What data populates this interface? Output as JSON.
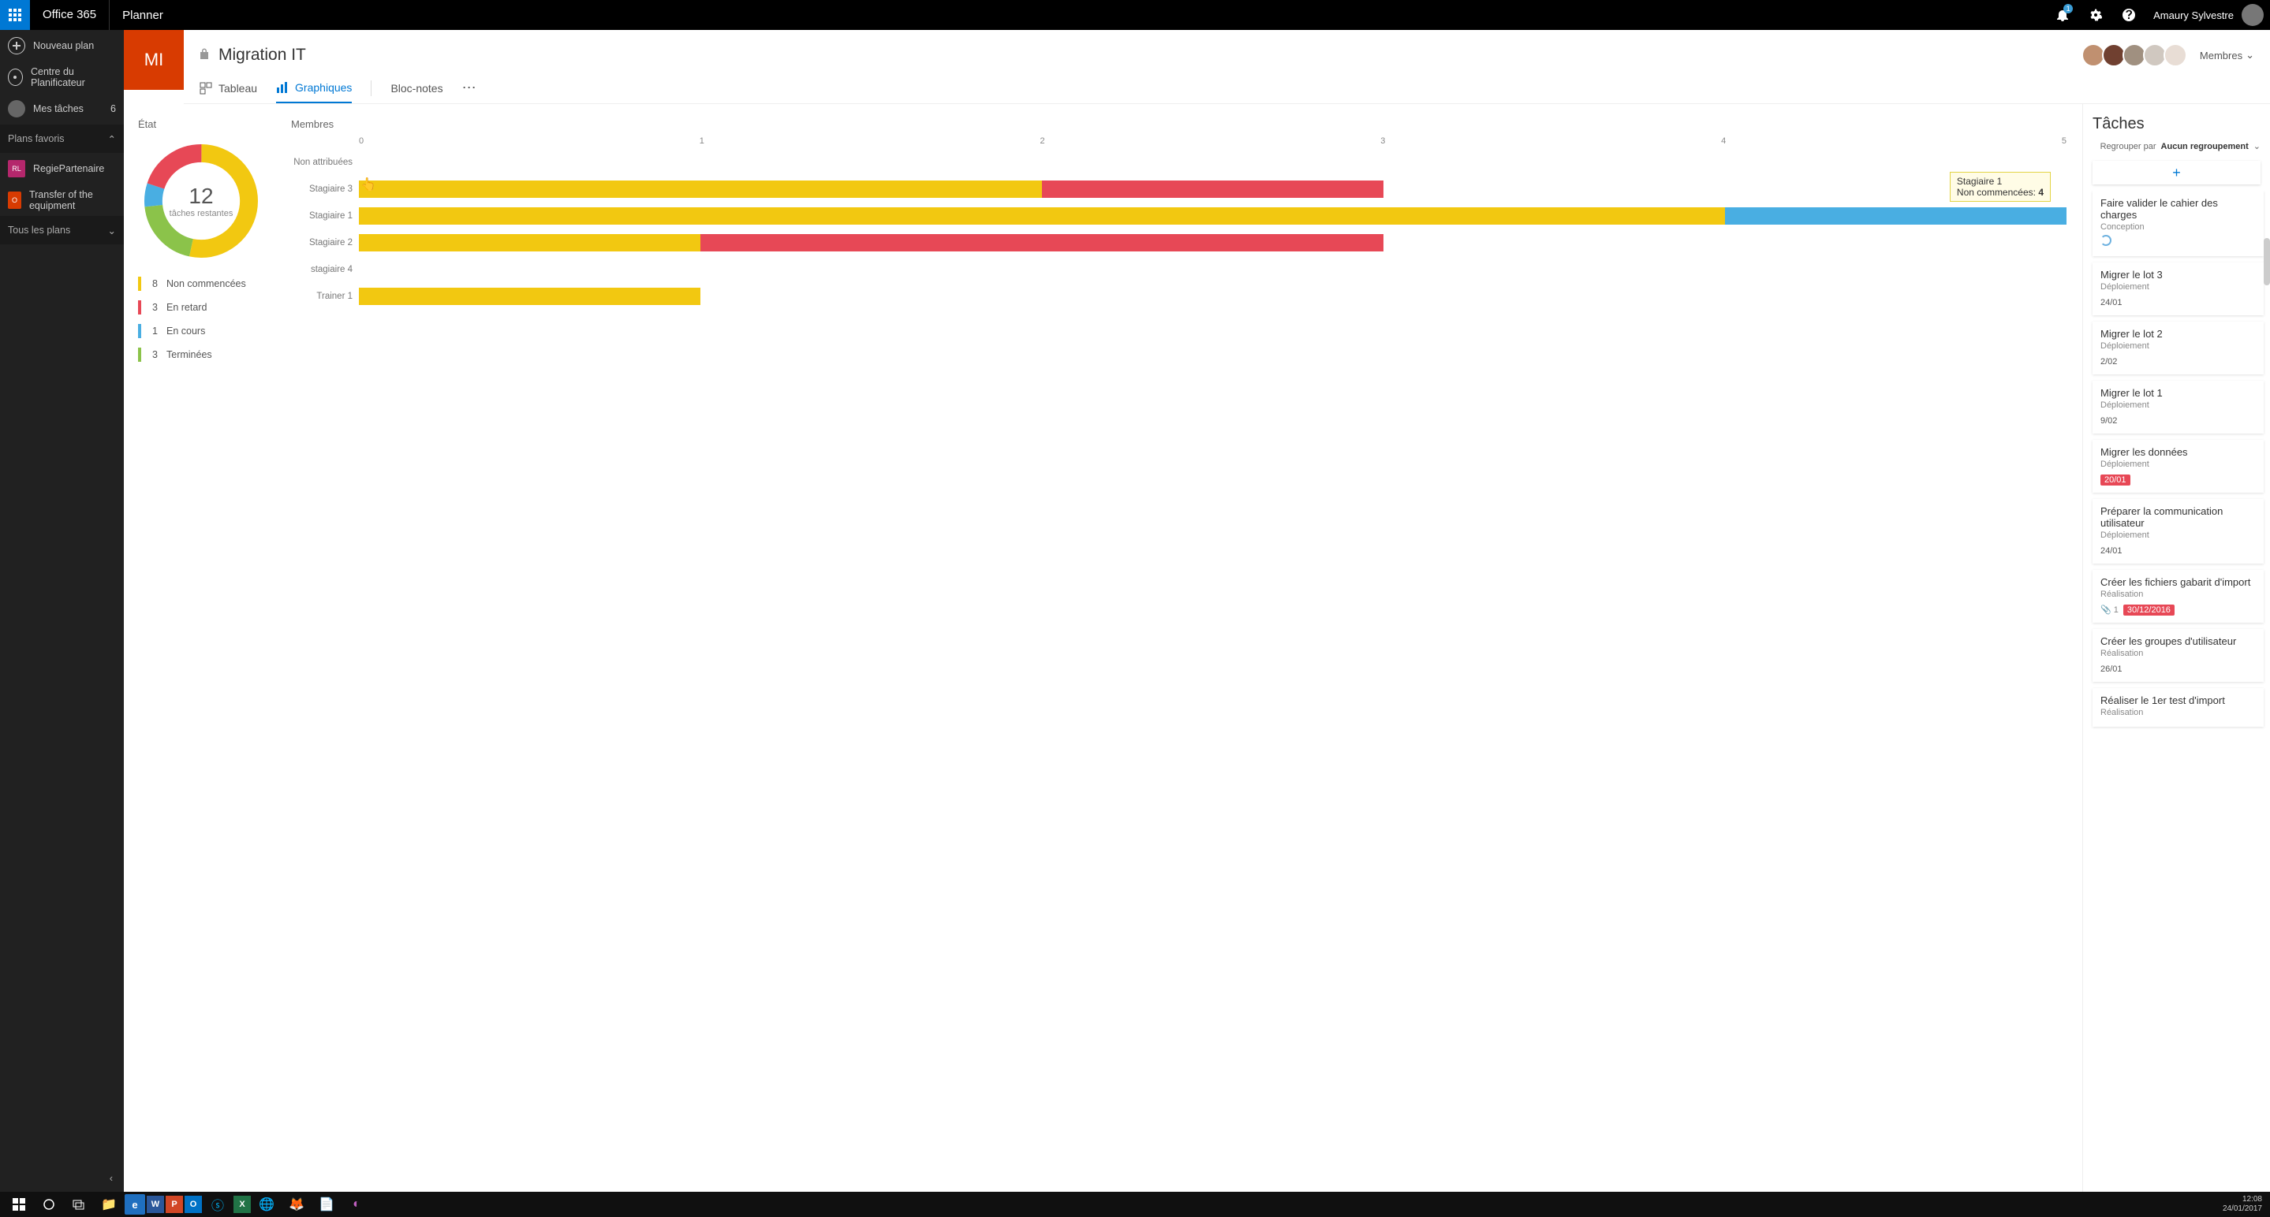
{
  "topbar": {
    "brand": "Office 365",
    "app": "Planner",
    "notifications": "1",
    "username": "Amaury Sylvestre"
  },
  "leftnav": {
    "new_plan": "Nouveau plan",
    "hub": "Centre du Planificateur",
    "my_tasks": "Mes tâches",
    "my_tasks_count": "6",
    "fav_header": "Plans favoris",
    "plans": [
      {
        "initials": "RL",
        "color": "#b4276c",
        "label": "RegiePartenaire"
      },
      {
        "initials": "O",
        "color": "#d83b01",
        "label": "Transfer of the equipment"
      }
    ],
    "all_plans_header": "Tous les plans"
  },
  "plan": {
    "initials": "MI",
    "title": "Migration IT",
    "members_label": "Membres",
    "tabs": {
      "board": "Tableau",
      "charts": "Graphiques",
      "notebook": "Bloc-notes"
    }
  },
  "etat": {
    "header": "État",
    "total": "12",
    "total_label": "tâches restantes",
    "legend": [
      {
        "count": "8",
        "label": "Non commencées",
        "color": "#f2c811"
      },
      {
        "count": "3",
        "label": "En retard",
        "color": "#e74856"
      },
      {
        "count": "1",
        "label": "En cours",
        "color": "#49aee2"
      },
      {
        "count": "3",
        "label": "Terminées",
        "color": "#8bc34a",
        "muted": true
      }
    ]
  },
  "chart_data": {
    "type": "bar",
    "title": "Membres",
    "xlabel": "",
    "ylabel": "",
    "xlim": [
      0,
      5
    ],
    "ticks": [
      "0",
      "1",
      "2",
      "3",
      "4",
      "5"
    ],
    "categories": [
      "Non attribuées",
      "Stagiaire 3",
      "Stagiaire 1",
      "Stagiaire 2",
      "stagiaire 4",
      "Trainer 1"
    ],
    "series": [
      {
        "name": "Non commencées",
        "color": "#f2c811",
        "values": [
          0,
          2,
          4,
          1,
          0,
          1
        ]
      },
      {
        "name": "En retard",
        "color": "#e74856",
        "values": [
          0,
          1,
          0,
          2,
          0,
          0
        ]
      },
      {
        "name": "En cours",
        "color": "#49aee2",
        "values": [
          0,
          0,
          1,
          0,
          0,
          0
        ]
      }
    ],
    "donut": {
      "Non commencées": 8,
      "En retard": 3,
      "En cours": 1,
      "Terminées": 3
    }
  },
  "tooltip": {
    "name": "Stagiaire 1",
    "status_label": "Non commencées:",
    "value": "4"
  },
  "taskpanel": {
    "header": "Tâches",
    "group_by_label": "Regrouper par",
    "group_by_value": "Aucun regroupement",
    "tasks": [
      {
        "title": "Faire valider le cahier des charges",
        "bucket": "Conception",
        "date": "",
        "status_ring": true
      },
      {
        "title": "Migrer le lot 3",
        "bucket": "Déploiement",
        "date": "24/01"
      },
      {
        "title": "Migrer le lot 2",
        "bucket": "Déploiement",
        "date": "2/02"
      },
      {
        "title": "Migrer le lot 1",
        "bucket": "Déploiement",
        "date": "9/02"
      },
      {
        "title": "Migrer les données",
        "bucket": "Déploiement",
        "date": "20/01",
        "overdue": true
      },
      {
        "title": "Préparer la communication utilisateur",
        "bucket": "Déploiement",
        "date": "24/01"
      },
      {
        "title": "Créer les fichiers gabarit d'import",
        "bucket": "Réalisation",
        "date": "30/12/2016",
        "overdue": true,
        "attach": "1"
      },
      {
        "title": "Créer les groupes d'utilisateur",
        "bucket": "Réalisation",
        "date": "26/01"
      },
      {
        "title": "Réaliser le 1er test d'import",
        "bucket": "Réalisation",
        "date": ""
      }
    ]
  },
  "winbar": {
    "time": "12:08",
    "date": "24/01/2017"
  }
}
